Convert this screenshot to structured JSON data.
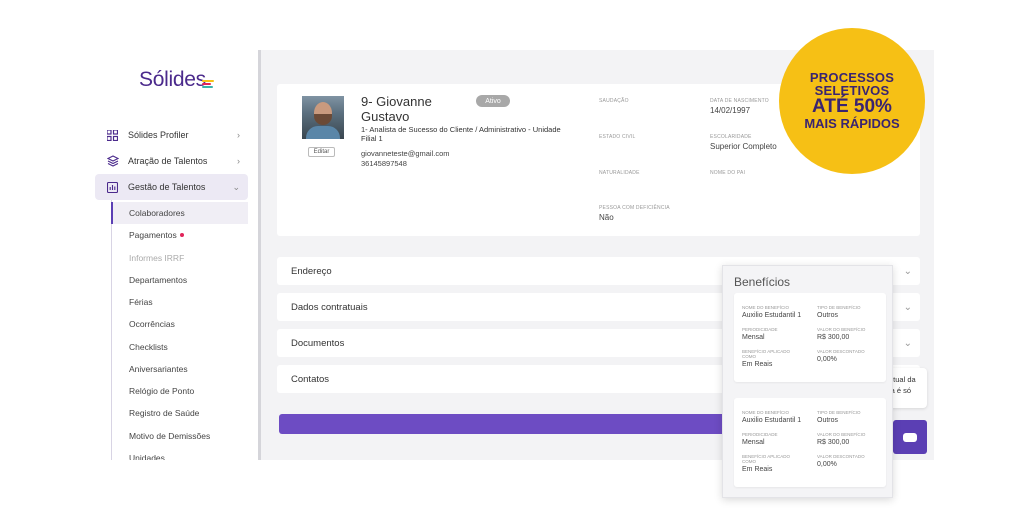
{
  "brand": {
    "logo_text": "Sólides",
    "logo_colors": [
      "#f6c015",
      "#e1245a",
      "#38b2ac"
    ]
  },
  "sidebar": {
    "menu": [
      {
        "label": "Sólides Profiler",
        "icon": "grid-icon",
        "chevron": "›"
      },
      {
        "label": "Atração de Talentos",
        "icon": "layers-icon",
        "chevron": "›"
      },
      {
        "label": "Gestão de Talentos",
        "icon": "chart-icon",
        "chevron": "⌄"
      }
    ],
    "submenu": [
      "Colaboradores",
      "Pagamentos",
      "Informes IRRF",
      "Departamentos",
      "Férias",
      "Ocorrências",
      "Checklists",
      "Aniversariantes",
      "Relógio de Ponto",
      "Registro de Saúde",
      "Motivo de Demissões",
      "Unidades"
    ]
  },
  "profile": {
    "name": "9- Giovanne Gustavo",
    "status": "Ativo",
    "role": "1- Analista de Sucesso do Cliente / Administrativo - Unidade Filial 1",
    "email": "giovanneteste@gmail.com",
    "phone": "36145897548",
    "edit_label": "Editar",
    "fields": {
      "saudacao": {
        "label": "Saudação",
        "value": ""
      },
      "nascimento": {
        "label": "Data de nascimento",
        "value": "14/02/1997"
      },
      "estado_civil": {
        "label": "Estado civil",
        "value": ""
      },
      "escolaridade": {
        "label": "Escolaridade",
        "value": "Superior Completo"
      },
      "naturalidade": {
        "label": "Naturalidade",
        "value": ""
      },
      "nome_pai": {
        "label": "Nome do pai",
        "value": ""
      },
      "deficiencia": {
        "label": "Pessoa com deficiência",
        "value": "Não"
      }
    }
  },
  "sections": [
    "Endereço",
    "Dados contratuais",
    "Documentos",
    "Contatos"
  ],
  "chat": {
    "line1": "ntual da",
    "line2": "la é só"
  },
  "beneficios": {
    "title": "Benefícios",
    "cards": [
      {
        "nome_label": "Nome do benefício",
        "nome": "Auxilio Estudantil 1",
        "tipo_label": "Tipo de benefício",
        "tipo": "Outros",
        "periodicidade_label": "Periodicidade",
        "periodicidade": "Mensal",
        "valor_label": "Valor do benefício",
        "valor": "R$ 300,00",
        "aplicado_label": "Benefício aplicado como",
        "aplicado": "Em Reais",
        "desconto_label": "Valor descontado",
        "desconto": "0,00%"
      },
      {
        "nome_label": "Nome do benefício",
        "nome": "Auxilio Estudantil 1",
        "tipo_label": "Tipo de benefício",
        "tipo": "Outros",
        "periodicidade_label": "Periodicidade",
        "periodicidade": "Mensal",
        "valor_label": "Valor do benefício",
        "valor": "R$ 300,00",
        "aplicado_label": "Benefício aplicado como",
        "aplicado": "Em Reais",
        "desconto_label": "Valor descontado",
        "desconto": "0,00%"
      }
    ]
  },
  "promo": {
    "line1": "PROCESSOS",
    "line2": "SELETIVOS",
    "line3": "ATÉ 50%",
    "line4": "MAIS RÁPIDOS"
  },
  "colors": {
    "primary": "#5b3fb4",
    "accent": "#f6c015",
    "alert": "#e1245a"
  }
}
